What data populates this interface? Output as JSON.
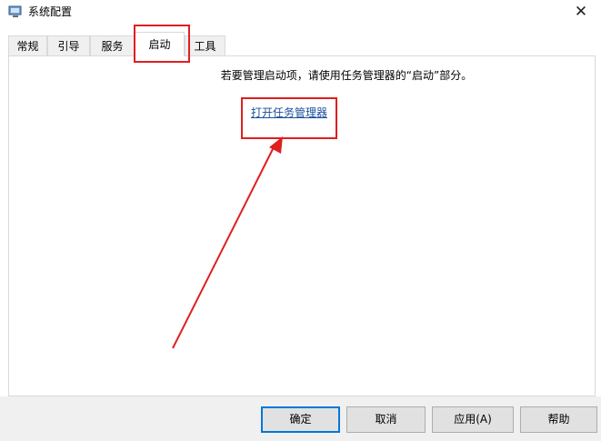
{
  "window": {
    "title": "系统配置",
    "close_glyph": "✕",
    "app_icon": "system-config-icon"
  },
  "tabs": [
    {
      "label": "常规",
      "active": false
    },
    {
      "label": "引导",
      "active": false
    },
    {
      "label": "服务",
      "active": false
    },
    {
      "label": "启动",
      "active": true
    },
    {
      "label": "工具",
      "active": false
    }
  ],
  "startup": {
    "message": "若要管理启动项，请使用任务管理器的“启动”部分。",
    "link": "打开任务管理器"
  },
  "buttons": {
    "ok": "确定",
    "cancel": "取消",
    "apply": "应用(A)",
    "help": "帮助"
  },
  "annotation_color": "#e01f1f",
  "accent_color": "#0078d7"
}
